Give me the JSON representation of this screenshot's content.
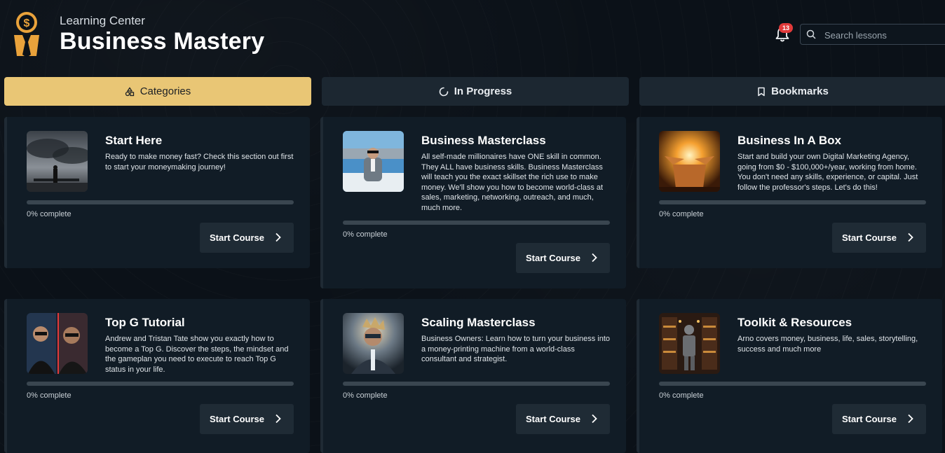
{
  "header": {
    "subtitle": "Learning Center",
    "title": "Business Mastery",
    "notification_count": "13",
    "search_placeholder": "Search lessons"
  },
  "tabs": [
    {
      "label": "Categories",
      "icon": "shapes-icon",
      "active": true
    },
    {
      "label": "In Progress",
      "icon": "loading-icon",
      "active": false
    },
    {
      "label": "Bookmarks",
      "icon": "bookmark-icon",
      "active": false
    }
  ],
  "courses": [
    {
      "title": "Start Here",
      "description": "Ready to make money fast? Check this section out first to start your moneymaking journey!",
      "progress_text": "0% complete",
      "progress": 0,
      "button": "Start Course",
      "thumbnail": "man-by-jet-under-storm-clouds"
    },
    {
      "title": "Business Masterclass",
      "description": "All self-made millionaires have ONE skill in common. They ALL have business skills. Business Masterclass will teach you the exact skillset the rich use to make money. We'll show you how to become world-class at sales, marketing, networking, outreach, and much, much more.",
      "progress_text": "0% complete",
      "progress": 0,
      "button": "Start Course",
      "thumbnail": "man-in-suit-on-yacht"
    },
    {
      "title": "Business In A Box",
      "description": "Start and build your own Digital Marketing Agency, going from $0 - $100,000+/year, working from home. You don't need any skills, experience, or capital. Just follow the professor's steps. Let's do this!",
      "progress_text": "0% complete",
      "progress": 0,
      "button": "Start Course",
      "thumbnail": "glowing-open-box"
    },
    {
      "title": "Top G Tutorial",
      "description": "Andrew and Tristan Tate show you exactly how to become a Top G. Discover the steps, the mindset and the gameplan you need to execute to reach Top G status in your life.",
      "progress_text": "0% complete",
      "progress": 0,
      "button": "Start Course",
      "thumbnail": "two-men-in-sunglasses"
    },
    {
      "title": "Scaling Masterclass",
      "description": "Business Owners: Learn how to turn your business into a money-printing machine from a world-class consultant and strategist.",
      "progress_text": "0% complete",
      "progress": 0,
      "button": "Start Course",
      "thumbnail": "man-with-sunglasses-explosion"
    },
    {
      "title": "Toolkit & Resources",
      "description": "Arno covers money, business, life, sales, storytelling, success and much more",
      "progress_text": "0% complete",
      "progress": 0,
      "button": "Start Course",
      "thumbnail": "armor-in-library"
    }
  ],
  "colors": {
    "accent": "#e9c675",
    "background": "#0b1118",
    "card": "#111c26",
    "button": "#1f2b35",
    "badge": "#e23a3a"
  }
}
